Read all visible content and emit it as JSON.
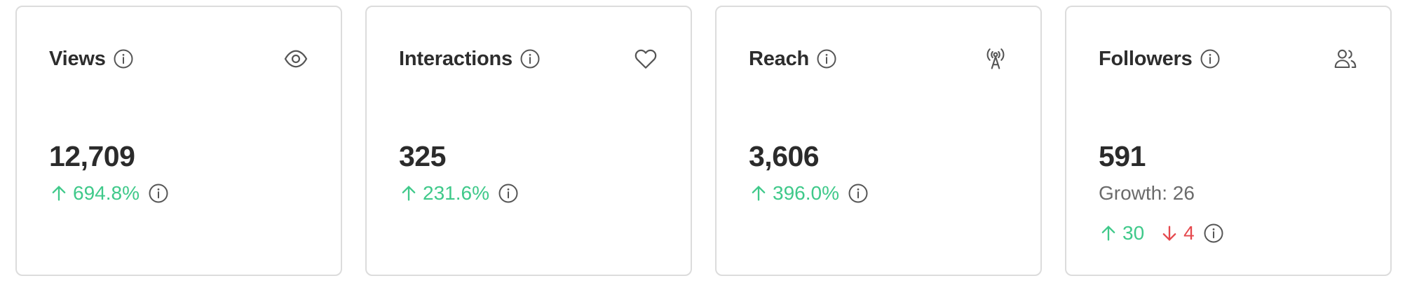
{
  "cards": [
    {
      "title": "Views",
      "icon": "eye-icon",
      "value": "12,709",
      "change": "694.8%",
      "direction": "up"
    },
    {
      "title": "Interactions",
      "icon": "heart-icon",
      "value": "325",
      "change": "231.6%",
      "direction": "up"
    },
    {
      "title": "Reach",
      "icon": "broadcast-tower-icon",
      "value": "3,606",
      "change": "396.0%",
      "direction": "up"
    },
    {
      "title": "Followers",
      "icon": "users-icon",
      "value": "591",
      "growth_label": "Growth: 26",
      "gained": "30",
      "lost": "4"
    }
  ],
  "colors": {
    "positive": "#3fc98a",
    "negative": "#e5484d",
    "border": "#dcdcdc",
    "text": "#2b2b2b",
    "muted": "#6b6b6b"
  }
}
